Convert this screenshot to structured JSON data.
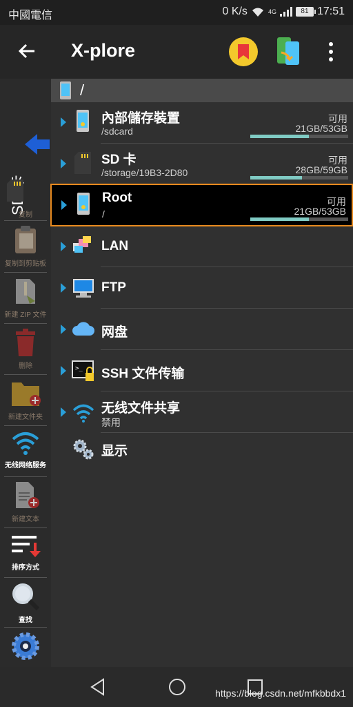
{
  "status": {
    "carrier": "中國電信",
    "speed": "0 K/s",
    "network": "4G",
    "battery": "81",
    "time": "17:51"
  },
  "titlebar": {
    "title": "X-plore",
    "bookmark_color": "#f3c92c"
  },
  "left_panel": {
    "pane_label": "SD 卡",
    "tools": [
      {
        "label": "复制",
        "icon": "copy-icon",
        "enabled": false
      },
      {
        "label": "复制到剪贴板",
        "icon": "clipboard-icon",
        "enabled": false
      },
      {
        "label": "新建 ZIP 文件",
        "icon": "zip-icon",
        "enabled": false
      },
      {
        "label": "删除",
        "icon": "trash-icon",
        "enabled": false
      },
      {
        "label": "新建文件夹",
        "icon": "new-folder-icon",
        "enabled": false
      },
      {
        "label": "无线网络服务",
        "icon": "wifi-icon",
        "enabled": true
      },
      {
        "label": "新建文本",
        "icon": "new-text-icon",
        "enabled": false
      },
      {
        "label": "排序方式",
        "icon": "sort-icon",
        "enabled": true
      },
      {
        "label": "查找",
        "icon": "search-icon",
        "enabled": true
      },
      {
        "label": "设置",
        "icon": "gear-icon",
        "enabled": true
      }
    ]
  },
  "path": {
    "current": "/"
  },
  "list": {
    "storages": [
      {
        "name": "內部儲存裝置",
        "path": "/sdcard",
        "avail_label": "可用",
        "size": "21GB/53GB",
        "used_fraction": 0.6,
        "icon": "phone-storage-icon"
      },
      {
        "name": "SD 卡",
        "path": "/storage/19B3-2D80",
        "avail_label": "可用",
        "size": "28GB/59GB",
        "used_fraction": 0.53,
        "icon": "sd-card-icon"
      },
      {
        "name": "Root",
        "path": "/",
        "avail_label": "可用",
        "size": "21GB/53GB",
        "used_fraction": 0.6,
        "icon": "root-storage-icon",
        "selected": true
      }
    ],
    "items": [
      {
        "name": "LAN",
        "icon": "lan-icon"
      },
      {
        "name": "FTP",
        "icon": "ftp-icon"
      },
      {
        "name": "网盘",
        "icon": "cloud-icon"
      },
      {
        "name": "SSH 文件传输",
        "icon": "ssh-icon"
      },
      {
        "name": "无线文件共享",
        "sub": "禁用",
        "icon": "wifi-share-icon"
      },
      {
        "name": "显示",
        "icon": "display-settings-icon"
      }
    ]
  },
  "watermark": "https://blog.csdn.net/mfkbbdx1",
  "colors": {
    "accent_blue": "#2a9fd8",
    "selection_outline": "#e88a1e",
    "usage_bar": "#80cbc4"
  }
}
